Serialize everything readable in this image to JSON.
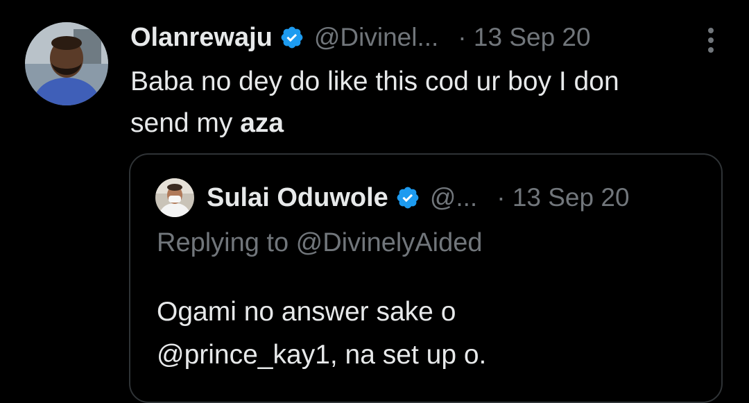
{
  "tweet": {
    "display_name": "Olanrewaju",
    "handle": "@Divinel...",
    "dot_time": "· 13 Sep 20",
    "text_line1": "Baba no dey do like this cod ur boy I don",
    "text_line2_plain": "send my ",
    "text_line2_bold": "aza",
    "more_icon": "more-vertical-icon",
    "verified_icon": "verified-badge-icon"
  },
  "quote": {
    "display_name": "Sulai Oduwole",
    "handle": "@...",
    "dot_time": "· 13 Sep 20",
    "replying_to": "Replying to @DivinelyAided",
    "text_line1": "Ogami no answer sake o",
    "text_line2": "@prince_kay1, na set up o."
  },
  "colors": {
    "background": "#000000",
    "primary_text": "#e7e9ea",
    "secondary_text": "#71767b",
    "border": "#2f3336",
    "verified_blue": "#1d9bf0"
  }
}
